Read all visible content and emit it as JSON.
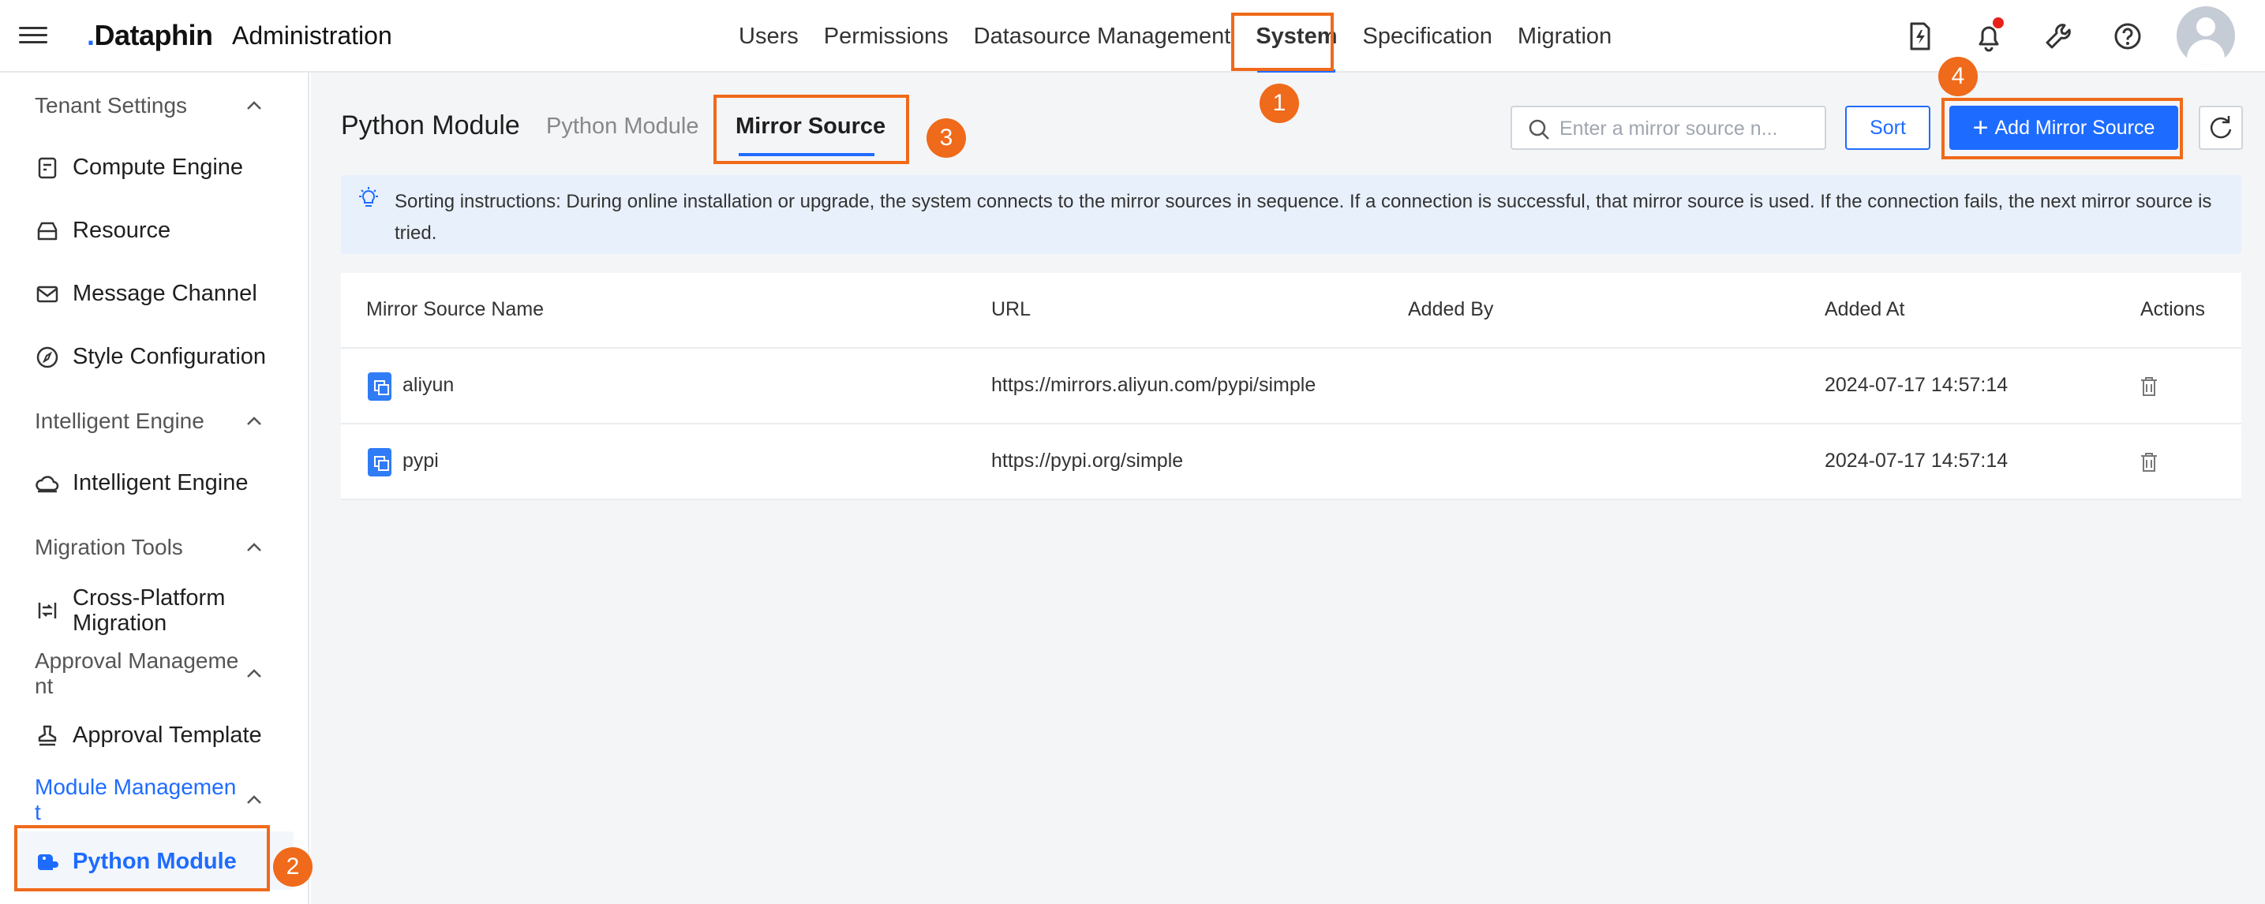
{
  "header": {
    "brand": "Dataphin",
    "app_name": "Administration",
    "nav": [
      "Users",
      "Permissions",
      "Datasource Management",
      "System",
      "Specification",
      "Migration"
    ],
    "active_nav": "System"
  },
  "sidebar": {
    "groups": [
      {
        "label": "Tenant Settings",
        "items": [
          "Compute Engine",
          "Resource",
          "Message Channel",
          "Style Configuration"
        ]
      },
      {
        "label": "Intelligent Engine",
        "items": [
          "Intelligent Engine"
        ]
      },
      {
        "label": "Migration Tools",
        "items": [
          "Cross-Platform Migration"
        ]
      },
      {
        "label": "Approval Manageme nt",
        "items": [
          "Approval Template"
        ]
      },
      {
        "label": "Module Managemen t",
        "items": [
          "Python Module"
        ]
      }
    ],
    "active_item": "Python Module"
  },
  "main": {
    "title": "Python Module",
    "tabs": [
      "Python Module",
      "Mirror Source"
    ],
    "active_tab": "Mirror Source",
    "search_placeholder": "Enter a mirror source n...",
    "sort_label": "Sort",
    "add_label": "Add Mirror Source",
    "notice": "Sorting instructions: During online installation or upgrade, the system connects to the mirror sources in sequence. If a connection is successful, that mirror source is used. If the connection fails, the next mirror source is tried.",
    "table": {
      "columns": [
        "Mirror Source Name",
        "URL",
        "Added By",
        "Added At",
        "Actions"
      ],
      "rows": [
        {
          "name": "aliyun",
          "url": "https://mirrors.aliyun.com/pypi/simple",
          "added_by": "",
          "added_at": "2024-07-17 14:57:14"
        },
        {
          "name": "pypi",
          "url": "https://pypi.org/simple",
          "added_by": "",
          "added_at": "2024-07-17 14:57:14"
        }
      ]
    }
  },
  "annotations": [
    "1",
    "2",
    "3",
    "4"
  ],
  "colors": {
    "accent": "#1e6cff",
    "highlight": "#ef6a1a",
    "notice_bg": "#e8f0fb",
    "notification_dot": "#e8201a"
  }
}
